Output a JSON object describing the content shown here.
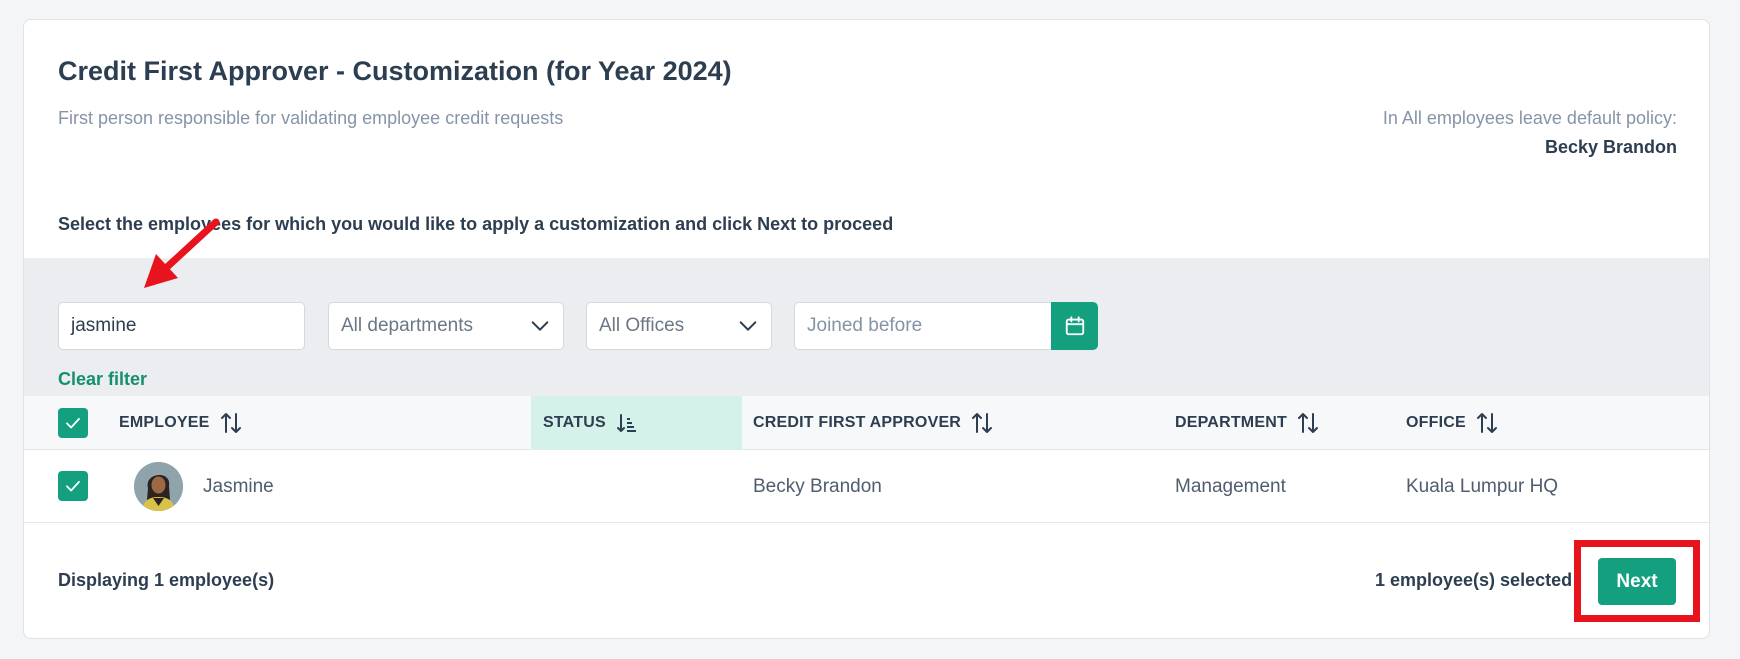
{
  "page": {
    "title": "Credit First Approver - Customization (for Year 2024)",
    "subtitle": "First person responsible for validating employee credit requests",
    "policy_label": "In All employees leave default policy:",
    "policy_value": "Becky Brandon",
    "instruction": "Select the employees for which you would like to apply a customization and click Next to proceed"
  },
  "filters": {
    "search_value": "jasmine",
    "department": "All departments",
    "office": "All Offices",
    "joined_before_placeholder": "Joined before",
    "clear_filter": "Clear filter"
  },
  "table": {
    "columns": {
      "employee": "EMPLOYEE",
      "status": "STATUS",
      "approver": "CREDIT FIRST APPROVER",
      "department": "DEPARTMENT",
      "office": "OFFICE"
    },
    "rows": [
      {
        "employee": "Jasmine",
        "status": "",
        "approver": "Becky Brandon",
        "department": "Management",
        "office": "Kuala Lumpur HQ"
      }
    ]
  },
  "footer": {
    "displaying": "Displaying 1 employee(s)",
    "selected": "1 employee(s) selected",
    "next": "Next"
  },
  "colors": {
    "accent": "#14a07f",
    "status_column_bg": "#d5f2ea",
    "annotation_red": "#e8141d",
    "title_text": "#2d3e50",
    "muted_text": "#8594a7"
  },
  "icons": {
    "dept_dropdown": "chevron-down-icon",
    "office_dropdown": "chevron-down-icon",
    "date_picker": "calendar-icon",
    "column_sort": "sort-arrows-icon",
    "status_sort": "sort-descending-icon",
    "checkbox": "check-icon"
  }
}
